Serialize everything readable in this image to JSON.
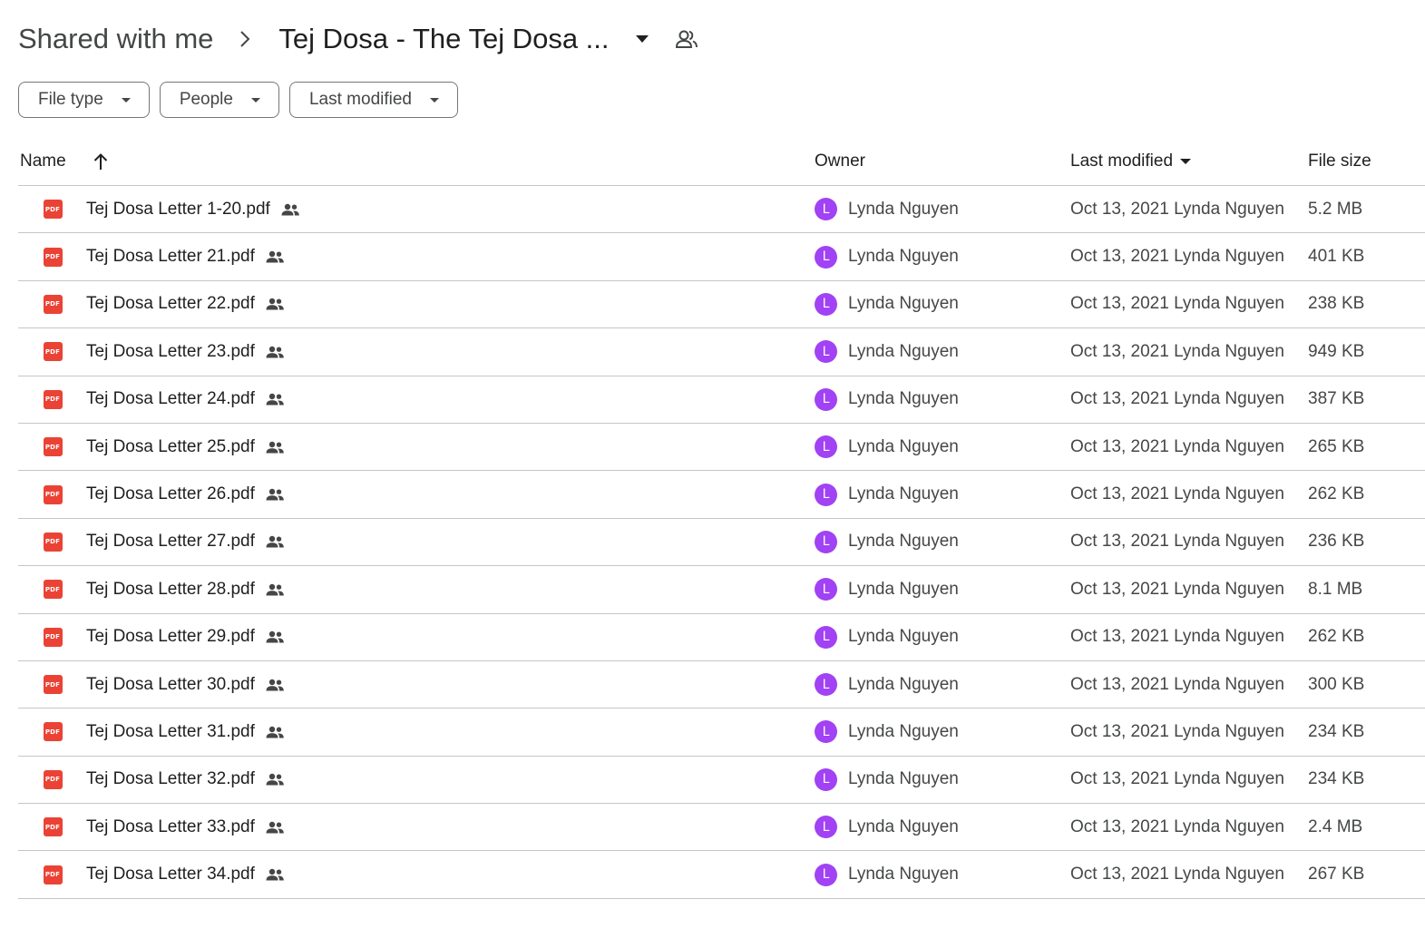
{
  "breadcrumb": {
    "root": "Shared with me",
    "current": "Tej Dosa - The Tej Dosa ..."
  },
  "filters": [
    {
      "label": "File type"
    },
    {
      "label": "People"
    },
    {
      "label": "Last modified"
    }
  ],
  "table": {
    "headers": {
      "name": "Name",
      "owner": "Owner",
      "modified": "Last modified",
      "size": "File size"
    },
    "icon_label": "PDF",
    "rows": [
      {
        "name": "Tej Dosa Letter 1-20.pdf",
        "owner_initial": "L",
        "owner": "Lynda Nguyen",
        "modified": "Oct 13, 2021 Lynda Nguyen",
        "size": "5.2 MB"
      },
      {
        "name": "Tej Dosa Letter 21.pdf",
        "owner_initial": "L",
        "owner": "Lynda Nguyen",
        "modified": "Oct 13, 2021 Lynda Nguyen",
        "size": "401 KB"
      },
      {
        "name": "Tej Dosa Letter 22.pdf",
        "owner_initial": "L",
        "owner": "Lynda Nguyen",
        "modified": "Oct 13, 2021 Lynda Nguyen",
        "size": "238 KB"
      },
      {
        "name": "Tej Dosa Letter 23.pdf",
        "owner_initial": "L",
        "owner": "Lynda Nguyen",
        "modified": "Oct 13, 2021 Lynda Nguyen",
        "size": "949 KB"
      },
      {
        "name": "Tej Dosa Letter 24.pdf",
        "owner_initial": "L",
        "owner": "Lynda Nguyen",
        "modified": "Oct 13, 2021 Lynda Nguyen",
        "size": "387 KB"
      },
      {
        "name": "Tej Dosa Letter 25.pdf",
        "owner_initial": "L",
        "owner": "Lynda Nguyen",
        "modified": "Oct 13, 2021 Lynda Nguyen",
        "size": "265 KB"
      },
      {
        "name": "Tej Dosa Letter 26.pdf",
        "owner_initial": "L",
        "owner": "Lynda Nguyen",
        "modified": "Oct 13, 2021 Lynda Nguyen",
        "size": "262 KB"
      },
      {
        "name": "Tej Dosa Letter 27.pdf",
        "owner_initial": "L",
        "owner": "Lynda Nguyen",
        "modified": "Oct 13, 2021 Lynda Nguyen",
        "size": "236 KB"
      },
      {
        "name": "Tej Dosa Letter 28.pdf",
        "owner_initial": "L",
        "owner": "Lynda Nguyen",
        "modified": "Oct 13, 2021 Lynda Nguyen",
        "size": "8.1 MB"
      },
      {
        "name": "Tej Dosa Letter 29.pdf",
        "owner_initial": "L",
        "owner": "Lynda Nguyen",
        "modified": "Oct 13, 2021 Lynda Nguyen",
        "size": "262 KB"
      },
      {
        "name": "Tej Dosa Letter 30.pdf",
        "owner_initial": "L",
        "owner": "Lynda Nguyen",
        "modified": "Oct 13, 2021 Lynda Nguyen",
        "size": "300 KB"
      },
      {
        "name": "Tej Dosa Letter 31.pdf",
        "owner_initial": "L",
        "owner": "Lynda Nguyen",
        "modified": "Oct 13, 2021 Lynda Nguyen",
        "size": "234 KB"
      },
      {
        "name": "Tej Dosa Letter 32.pdf",
        "owner_initial": "L",
        "owner": "Lynda Nguyen",
        "modified": "Oct 13, 2021 Lynda Nguyen",
        "size": "234 KB"
      },
      {
        "name": "Tej Dosa Letter 33.pdf",
        "owner_initial": "L",
        "owner": "Lynda Nguyen",
        "modified": "Oct 13, 2021 Lynda Nguyen",
        "size": "2.4 MB"
      },
      {
        "name": "Tej Dosa Letter 34.pdf",
        "owner_initial": "L",
        "owner": "Lynda Nguyen",
        "modified": "Oct 13, 2021 Lynda Nguyen",
        "size": "267 KB"
      }
    ]
  },
  "colors": {
    "avatar": "#a142f4",
    "pdf_icon": "#ea4335",
    "divider": "#c4c7c5"
  }
}
